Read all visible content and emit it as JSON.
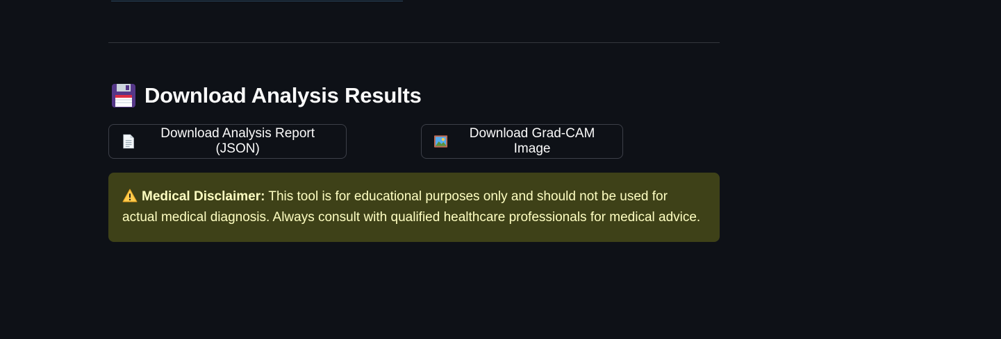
{
  "section": {
    "heading": "Download Analysis Results",
    "heading_icon": "floppy-disk-icon"
  },
  "buttons": {
    "json_report": {
      "label": "Download Analysis Report (JSON)",
      "icon": "document-icon"
    },
    "gradcam_image": {
      "label": "Download Grad-CAM Image",
      "icon": "framed-picture-icon"
    }
  },
  "disclaimer": {
    "icon": "warning-icon",
    "title": "Medical Disclaimer:",
    "body": " This tool is for educational purposes only and should not be used for actual medical diagnosis. Always consult with qualified healthcare professionals for medical advice."
  },
  "colors": {
    "background": "#0e1117",
    "warning_bg": "#3e4118",
    "warning_text": "#ffffc2"
  }
}
